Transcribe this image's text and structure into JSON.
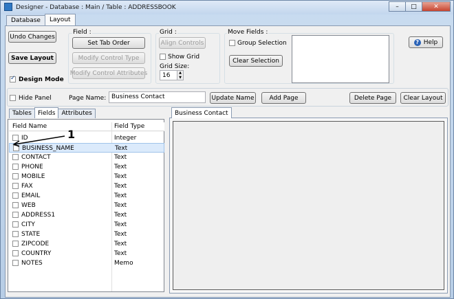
{
  "window": {
    "title": "Designer - Database : Main / Table : ADDRESSBOOK",
    "min": "–",
    "max": "□",
    "close": "✕"
  },
  "top_tabs": [
    "Database",
    "Layout"
  ],
  "toolbar": {
    "undo_label": "Undo Changes",
    "save_label": "Save Layout",
    "design_mode_label": "Design Mode",
    "field_group_label": "Field :",
    "set_tab_order": "Set Tab Order",
    "modify_control_type": "Modify Control Type",
    "modify_control_attributes": "Modify Control Attributes",
    "grid_group_label": "Grid :",
    "align_controls": "Align Controls",
    "show_grid_label": "Show Grid",
    "grid_size_label": "Grid Size:",
    "grid_size_value": "16",
    "move_fields_label": "Move Fields :",
    "group_selection_label": "Group Selection",
    "clear_selection": "Clear Selection",
    "help_label": "Help"
  },
  "page_bar": {
    "hide_panel_label": "Hide Panel",
    "page_name_label": "Page Name:",
    "page_name_value": "Business Contact",
    "update_name": "Update Name",
    "add_page": "Add Page",
    "delete_page": "Delete Page",
    "clear_layout": "Clear Layout"
  },
  "left_tabs": [
    "Tables",
    "Fields",
    "Attributes"
  ],
  "fields_table": {
    "headers": [
      "Field Name",
      "Field Type"
    ],
    "rows": [
      {
        "name": "ID",
        "type": "Integer"
      },
      {
        "name": "BUSINESS_NAME",
        "type": "Text"
      },
      {
        "name": "CONTACT",
        "type": "Text"
      },
      {
        "name": "PHONE",
        "type": "Text"
      },
      {
        "name": "MOBILE",
        "type": "Text"
      },
      {
        "name": "FAX",
        "type": "Text"
      },
      {
        "name": "EMAIL",
        "type": "Text"
      },
      {
        "name": "WEB",
        "type": "Text"
      },
      {
        "name": "ADDRESS1",
        "type": "Text"
      },
      {
        "name": "CITY",
        "type": "Text"
      },
      {
        "name": "STATE",
        "type": "Text"
      },
      {
        "name": "ZIPCODE",
        "type": "Text"
      },
      {
        "name": "COUNTRY",
        "type": "Text"
      },
      {
        "name": "NOTES",
        "type": "Memo"
      }
    ]
  },
  "page_tab": "Business Contact",
  "annotation": "1"
}
